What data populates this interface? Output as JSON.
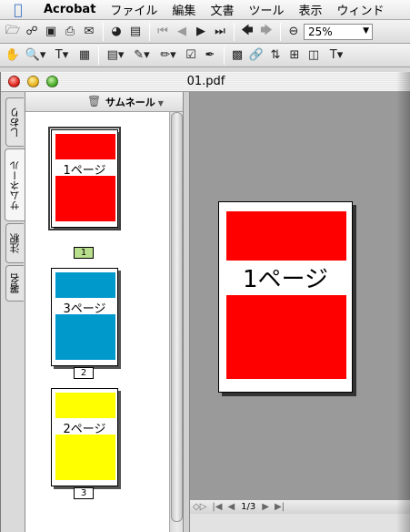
{
  "menubar": {
    "app": "Acrobat",
    "items": [
      "ファイル",
      "編集",
      "文書",
      "ツール",
      "表示",
      "ウィンド"
    ]
  },
  "toolbar": {
    "zoom_value": "25%"
  },
  "window": {
    "title": "01.pdf"
  },
  "side_tabs": [
    "しおり",
    "サムネール",
    "注釈",
    "署名"
  ],
  "thumb_panel": {
    "menu_label": "サムネール"
  },
  "thumbnails": [
    {
      "label": "1ページ",
      "page_number": "1",
      "color": "#ff0000"
    },
    {
      "label": "3ページ",
      "page_number": "2",
      "color": "#0099cc"
    },
    {
      "label": "2ページ",
      "page_number": "3",
      "color": "#ffff00"
    }
  ],
  "document": {
    "page_label": "1ページ",
    "page_color": "#ff0000"
  },
  "status": {
    "page_indicator": "1/3"
  }
}
